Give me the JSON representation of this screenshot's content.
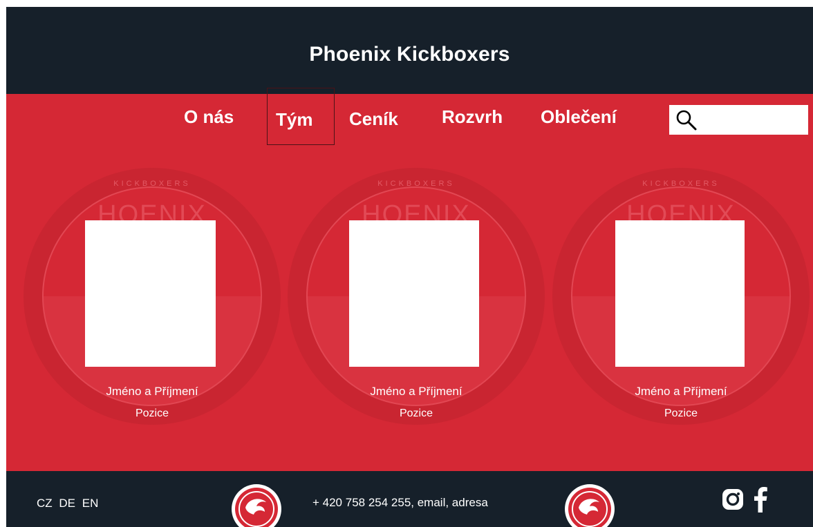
{
  "header": {
    "title": "Phoenix Kickboxers"
  },
  "nav": {
    "items": [
      "O nás",
      "Tým",
      "Ceník",
      "Rozvrh",
      "Oblečení"
    ],
    "active": "Tým",
    "search_placeholder": ""
  },
  "emblem_text": {
    "top": "KICKBOXERS",
    "middle": "HOENIX"
  },
  "team": [
    {
      "name": "Jméno a Příjmení",
      "role": "Pozice"
    },
    {
      "name": "Jméno a Příjmení",
      "role": "Pozice"
    },
    {
      "name": "Jméno a Příjmení",
      "role": "Pozice"
    }
  ],
  "footer": {
    "languages": [
      "CZ",
      "DE",
      "EN"
    ],
    "contact": "+ 420 758 254 255, email, adresa"
  },
  "colors": {
    "dark": "#16202a",
    "red": "#d52835",
    "white": "#ffffff"
  },
  "icons": [
    "search-icon",
    "phoenix-logo-icon",
    "instagram-icon",
    "facebook-icon"
  ]
}
